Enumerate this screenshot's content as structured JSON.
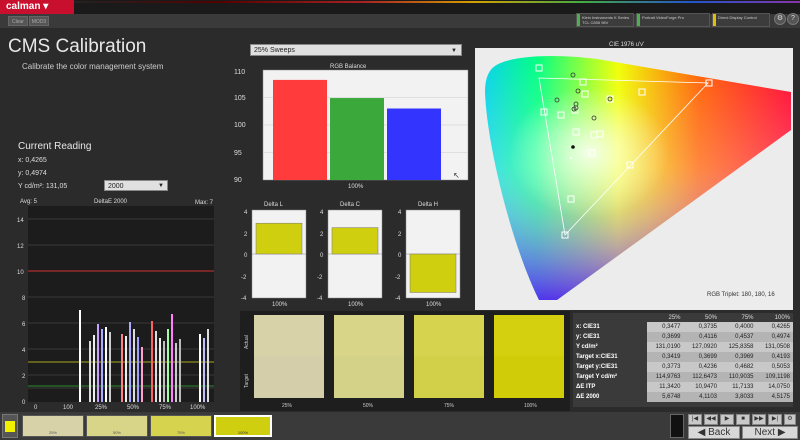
{
  "app": {
    "brand": "calman",
    "tabs": [
      "Clear",
      "MOD3"
    ]
  },
  "devices": [
    {
      "line1": "Klein Instruments K Series",
      "line2": "TCL C855 98V",
      "status_color": "#4caf50"
    },
    {
      "line1": "Portrait VideoForge Pro",
      "line2": "",
      "status_color": "#4caf50"
    },
    {
      "line1": "Direct Display Control",
      "line2": "",
      "status_color": "#e0c000"
    }
  ],
  "header": {
    "title": "CMS Calibration",
    "subtitle": "Calibrate the color management system"
  },
  "current_reading": {
    "title": "Current Reading",
    "x_line": "x: 0,4265",
    "y_line": "y: 0,4974",
    "Y_line": "Y cd/m²: 131,05",
    "de_select": "2000"
  },
  "sweep_select": "25% Sweeps",
  "colors": {
    "accent_red": "#c8102e",
    "sweep_yellow": "#cfcf10",
    "panel_bg": "#2b2b2b"
  },
  "charts": {
    "delta_e": {
      "title": "DeltaE 2000",
      "avg": "Avg: 5",
      "max": "Max: 7",
      "yticks": [
        "0",
        "2",
        "4",
        "6",
        "8",
        "10",
        "12",
        "14"
      ],
      "xticks": [
        "0",
        "100",
        "25%",
        "50%",
        "75%",
        "100%"
      ]
    },
    "rgb_balance": {
      "title": "RGB Balance",
      "yticks": [
        "90",
        "95",
        "100",
        "105",
        "110"
      ],
      "xlabel": "100%"
    },
    "delta_l": {
      "title": "Delta L",
      "yticks": [
        "4",
        "2",
        "0",
        "-2",
        "-4"
      ],
      "xlabel": "100%"
    },
    "delta_c": {
      "title": "Delta C",
      "yticks": [
        "4",
        "2",
        "0",
        "-2",
        "-4"
      ],
      "xlabel": "100%"
    },
    "delta_h": {
      "title": "Delta H",
      "yticks": [
        "4",
        "2",
        "0",
        "-2",
        "-4"
      ],
      "xlabel": "100%"
    },
    "cie": {
      "title": "CIE 1976 u'v'",
      "triplet": "RGB Triplet: 180, 180, 16"
    }
  },
  "chart_data": [
    {
      "type": "bar",
      "title": "RGB Balance",
      "categories": [
        "R",
        "G",
        "B"
      ],
      "values": [
        108.2,
        104.9,
        103.0
      ],
      "ylim": [
        90,
        110
      ],
      "colors": [
        "#ff3b3b",
        "#3aa83a",
        "#3434ff"
      ]
    },
    {
      "type": "bar",
      "title": "Delta L",
      "categories": [
        "100%"
      ],
      "values": [
        2.8
      ],
      "ylim": [
        -4,
        4
      ]
    },
    {
      "type": "bar",
      "title": "Delta C",
      "categories": [
        "100%"
      ],
      "values": [
        2.4
      ],
      "ylim": [
        -4,
        4
      ]
    },
    {
      "type": "bar",
      "title": "Delta H",
      "categories": [
        "100%"
      ],
      "values": [
        -3.5
      ],
      "ylim": [
        -4,
        4
      ]
    }
  ],
  "swatch_panel": {
    "actual_label": "Actual",
    "target_label": "Target",
    "swatches": [
      {
        "label": "25%",
        "actual": "#d8d2a8",
        "target": "#d4ceaa"
      },
      {
        "label": "50%",
        "actual": "#d8d488",
        "target": "#d4d288"
      },
      {
        "label": "75%",
        "actual": "#d6d44e",
        "target": "#d2d048"
      },
      {
        "label": "100%",
        "actual": "#d4d010",
        "target": "#d0cc08"
      }
    ]
  },
  "table": {
    "headers": [
      "",
      "25%",
      "50%",
      "75%",
      "100%"
    ],
    "rows": [
      [
        "x: CIE31",
        "0,3477",
        "0,3735",
        "0,4000",
        "0,4265"
      ],
      [
        "y: CIE31",
        "0,3699",
        "0,4116",
        "0,4537",
        "0,4974"
      ],
      [
        "Y cd/m²",
        "131,0190",
        "127,0920",
        "125,8358",
        "131,0508"
      ],
      [
        "Target x:CIE31",
        "0,3419",
        "0,3699",
        "0,3969",
        "0,4193"
      ],
      [
        "Target y:CIE31",
        "0,3773",
        "0,4236",
        "0,4682",
        "0,5053"
      ],
      [
        "Target Y cd/m²",
        "114,9763",
        "112,6473",
        "110,9035",
        "109,1198"
      ],
      [
        "ΔE ITP",
        "11,3420",
        "10,9470",
        "11,7133",
        "14,0750"
      ],
      [
        "ΔE 2000",
        "5,6748",
        "4,1103",
        "3,8033",
        "4,5175"
      ]
    ]
  },
  "bottom": {
    "thumbs": [
      {
        "label": "25%",
        "color": "#d8d2a8"
      },
      {
        "label": "50%",
        "color": "#d8d488"
      },
      {
        "label": "75%",
        "color": "#d6d44e"
      },
      {
        "label": "100%",
        "color": "#cfcf10"
      }
    ],
    "back": "Back",
    "next": "Next"
  }
}
